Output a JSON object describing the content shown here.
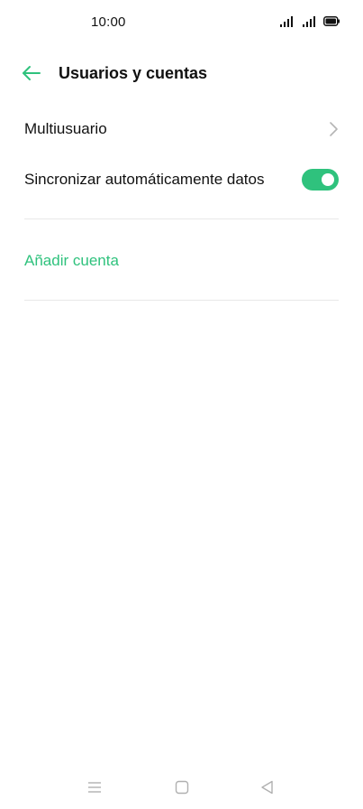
{
  "status_bar": {
    "time": "10:00"
  },
  "header": {
    "title": "Usuarios y cuentas",
    "back_icon": "arrow-left-icon"
  },
  "settings": {
    "multiuser_label": "Multiusuario",
    "sync_label": "Sincronizar automáticamente datos",
    "sync_enabled": true,
    "add_account_label": "Añadir cuenta"
  },
  "colors": {
    "accent": "#2fc27d",
    "divider": "#e8e8e8",
    "text": "#111111"
  },
  "nav_bar": {
    "icons": [
      "menu-icon",
      "home-square-icon",
      "back-triangle-icon"
    ]
  }
}
